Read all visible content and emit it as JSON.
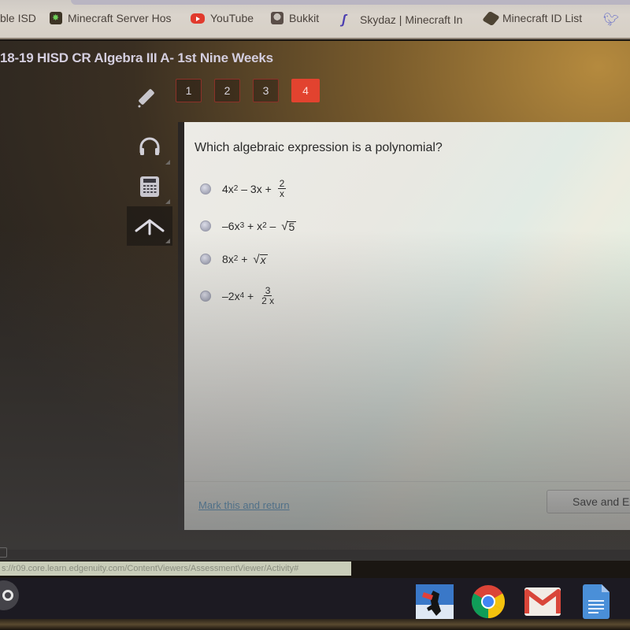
{
  "bookmarks": [
    {
      "label": "ble ISD",
      "icon": "none"
    },
    {
      "label": "Minecraft Server Hos",
      "icon": "minecraft-server-icon"
    },
    {
      "label": "YouTube",
      "icon": "youtube-icon"
    },
    {
      "label": "Bukkit",
      "icon": "bukkit-icon"
    },
    {
      "label": "Skydaz | Minecraft In",
      "icon": "skydaz-icon"
    },
    {
      "label": "Minecraft ID List",
      "icon": "minecraft-id-icon"
    },
    {
      "label": "",
      "icon": "twitter-icon"
    }
  ],
  "course": {
    "title": "18-19 HISD CR Algebra III A- 1st Nine Weeks"
  },
  "question_nav": {
    "items": [
      "1",
      "2",
      "3",
      "4"
    ],
    "active_index": 3
  },
  "tools": [
    {
      "name": "pencil-icon"
    },
    {
      "name": "headphones-icon"
    },
    {
      "name": "calculator-icon"
    },
    {
      "name": "reference-icon"
    }
  ],
  "question": {
    "prompt": "Which algebraic expression is a polynomial?",
    "choices": [
      {
        "text": "4x² – 3x + 2/x",
        "parts": {
          "a": "4x",
          "a_exp": "2",
          "b": " – 3x + ",
          "num": "2",
          "den": "x"
        }
      },
      {
        "text": "–6x³ + x² – √5",
        "parts": {
          "a": "–6x",
          "a_exp": "3",
          "b": " + x",
          "b_exp": "2",
          "c": " – ",
          "rad": "5"
        }
      },
      {
        "text": "8x² + √x",
        "parts": {
          "a": "8x",
          "a_exp": "2",
          "b": " + ",
          "rad": "x"
        }
      },
      {
        "text": "–2x⁴ + 3/(2x)",
        "parts": {
          "a": "–2x",
          "a_exp": "4",
          "b": " + ",
          "num": "3",
          "den": "2 x"
        }
      }
    ],
    "selected": null
  },
  "footer": {
    "mark_link": "Mark this and return",
    "save_button": "Save and Exit"
  },
  "status_url": "s://r09.core.learn.edgenuity.com/ContentViewers/AssessmentViewer/Activity#",
  "shelf": {
    "apps": [
      "game-app-icon",
      "chrome-icon",
      "gmail-icon",
      "docs-icon"
    ]
  },
  "colors": {
    "accent_red": "#e2432f",
    "link_blue": "#5a9ac8"
  }
}
